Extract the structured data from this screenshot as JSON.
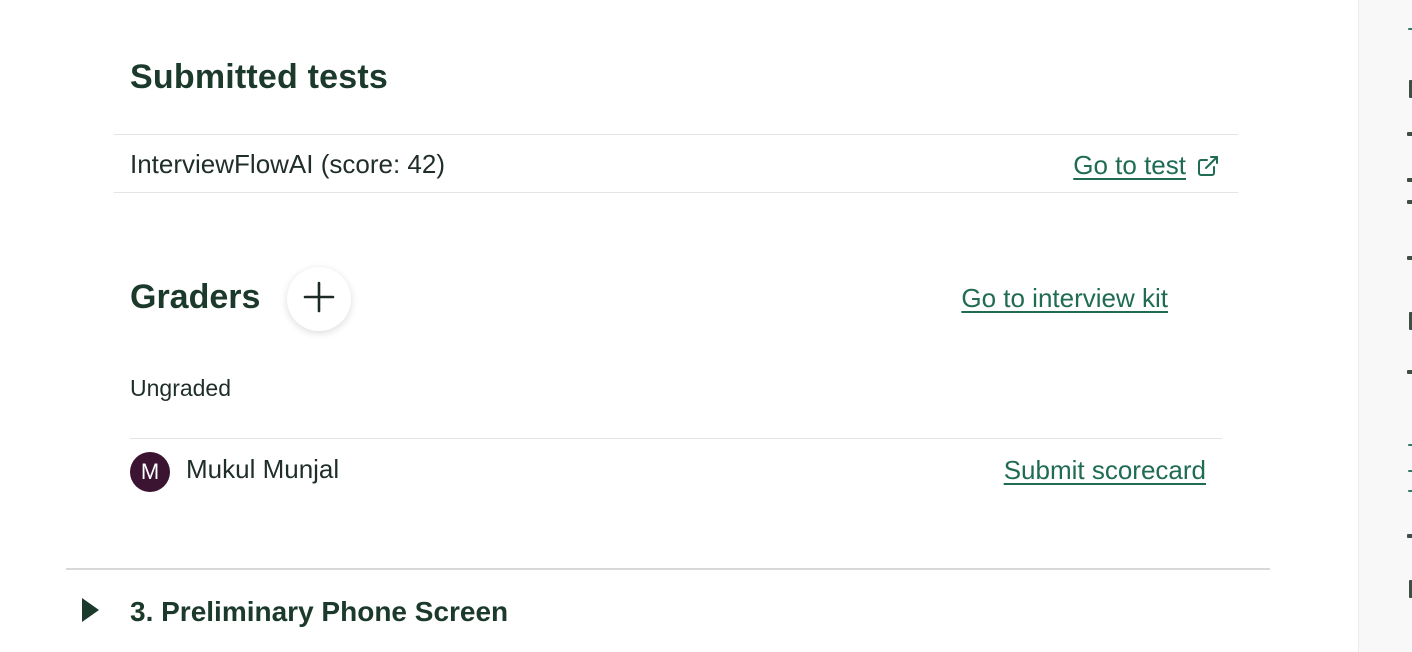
{
  "submitted_tests": {
    "title": "Submitted tests",
    "items": [
      {
        "name": "InterviewFlowAI (score: 42)",
        "link_label": "Go to test",
        "link_icon": "external-link-icon"
      }
    ]
  },
  "graders": {
    "title": "Graders",
    "add_icon": "plus-icon",
    "kit_link_label": "Go to interview kit",
    "status_label": "Ungraded",
    "list": [
      {
        "avatar_initial": "M",
        "avatar_color": "#3a1431",
        "name": "Mukul Munjal",
        "action_label": "Submit scorecard"
      }
    ]
  },
  "next_stage": {
    "label": "3. Preliminary Phone Screen",
    "icon": "caret-right-icon"
  },
  "colors": {
    "heading": "#1b3a2c",
    "link": "#1f6b54",
    "text": "#1f2e27",
    "divider": "#e3e5e3"
  }
}
